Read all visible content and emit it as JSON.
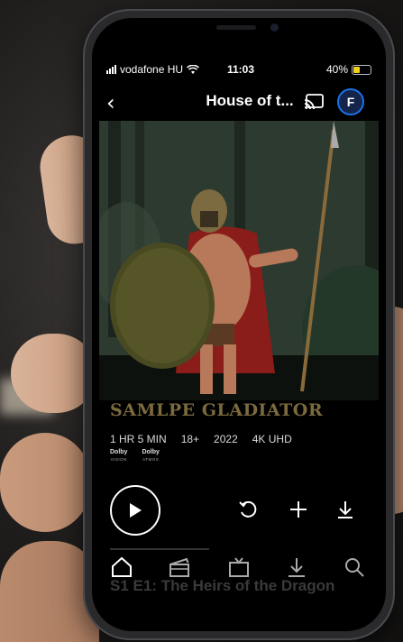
{
  "status_bar": {
    "carrier": "vodafone HU",
    "time": "11:03",
    "battery": "40%"
  },
  "nav": {
    "back_glyph": "‹",
    "title": "House of t...",
    "profile_initial": "F"
  },
  "show": {
    "title": "SAMLPE GLADIATOR",
    "meta": [
      "1 HR 5 MIN",
      "18+",
      "2022",
      "4K UHD"
    ],
    "dolby": [
      {
        "label": "Dolby",
        "sub": "VISION"
      },
      {
        "label": "Dolby",
        "sub": "ATMOS"
      }
    ]
  },
  "episode_ghost": "S1 E1: The Heirs of the Dragon",
  "icons": {
    "signal": "signal-icon",
    "wifi": "wifi-icon",
    "cast": "cast-icon",
    "play": "play-icon",
    "restart": "restart-icon",
    "add": "add-icon",
    "download": "download-icon",
    "home": "home-icon",
    "movies": "clapperboard-icon",
    "tv": "tv-icon",
    "search": "search-icon"
  },
  "colors": {
    "title_gold": "#7a6a3e",
    "profile_ring": "#1a73e8",
    "battery": "#f2d21b"
  }
}
